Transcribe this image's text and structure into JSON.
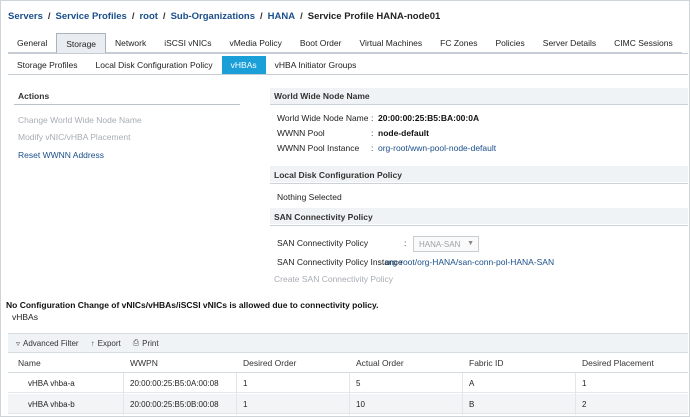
{
  "breadcrumb": {
    "items": [
      "Servers",
      "Service Profiles",
      "root",
      "Sub-Organizations",
      "HANA"
    ],
    "current": "Service Profile HANA-node01",
    "separator": "/"
  },
  "tabs": [
    {
      "label": "General",
      "active": false
    },
    {
      "label": "Storage",
      "active": true
    },
    {
      "label": "Network",
      "active": false
    },
    {
      "label": "iSCSI vNICs",
      "active": false
    },
    {
      "label": "vMedia Policy",
      "active": false
    },
    {
      "label": "Boot Order",
      "active": false
    },
    {
      "label": "Virtual Machines",
      "active": false
    },
    {
      "label": "FC Zones",
      "active": false
    },
    {
      "label": "Policies",
      "active": false
    },
    {
      "label": "Server Details",
      "active": false
    },
    {
      "label": "CIMC Sessions",
      "active": false
    }
  ],
  "subtabs": [
    {
      "label": "Storage Profiles",
      "active": false
    },
    {
      "label": "Local Disk Configuration Policy",
      "active": false
    },
    {
      "label": "vHBAs",
      "active": true
    },
    {
      "label": "vHBA Initiator Groups",
      "active": false
    }
  ],
  "actions": {
    "title": "Actions",
    "items": [
      {
        "label": "Change World Wide Node Name",
        "enabled": false
      },
      {
        "label": "Modify vNIC/vHBA Placement",
        "enabled": false
      },
      {
        "label": "Reset WWNN Address",
        "enabled": true
      }
    ]
  },
  "wwnn": {
    "title": "World Wide Node Name",
    "name_label": "World Wide Node Name",
    "name_value": "20:00:00:25:B5:BA:00:0A",
    "pool_label": "WWNN Pool",
    "pool_value": "node-default",
    "instance_label": "WWNN Pool Instance",
    "instance_value": "org-root/wwn-pool-node-default"
  },
  "local_disk": {
    "title": "Local Disk Configuration Policy",
    "value": "Nothing Selected"
  },
  "san": {
    "title": "SAN Connectivity Policy",
    "policy_label": "SAN Connectivity Policy",
    "policy_value": "HANA-SAN",
    "instance_label": "SAN Connectivity Policy Instance",
    "instance_value": "org-root/org-HANA/san-conn-pol-HANA-SAN",
    "create_label": "Create SAN Connectivity Policy"
  },
  "warning": "No Configuration Change of vNICs/vHBAs/iSCSI vNICs is allowed due to connectivity policy.",
  "vhbas_label": "vHBAs",
  "toolbar": {
    "filter": "Advanced Filter",
    "export": "Export",
    "print": "Print"
  },
  "table": {
    "columns": [
      "Name",
      "WWPN",
      "Desired Order",
      "Actual Order",
      "Fabric ID",
      "Desired Placement"
    ],
    "rows": [
      [
        "vHBA vhba-a",
        "20:00:00:25:B5:0A:00:08",
        "1",
        "5",
        "A",
        "1"
      ],
      [
        "vHBA vhba-b",
        "20:00:00:25:B5:0B:00:08",
        "1",
        "10",
        "B",
        "2"
      ]
    ]
  },
  "colors": {
    "link": "#1a4f8b",
    "active_subtab": "#1b9fd8",
    "disabled": "#a8adb3"
  }
}
